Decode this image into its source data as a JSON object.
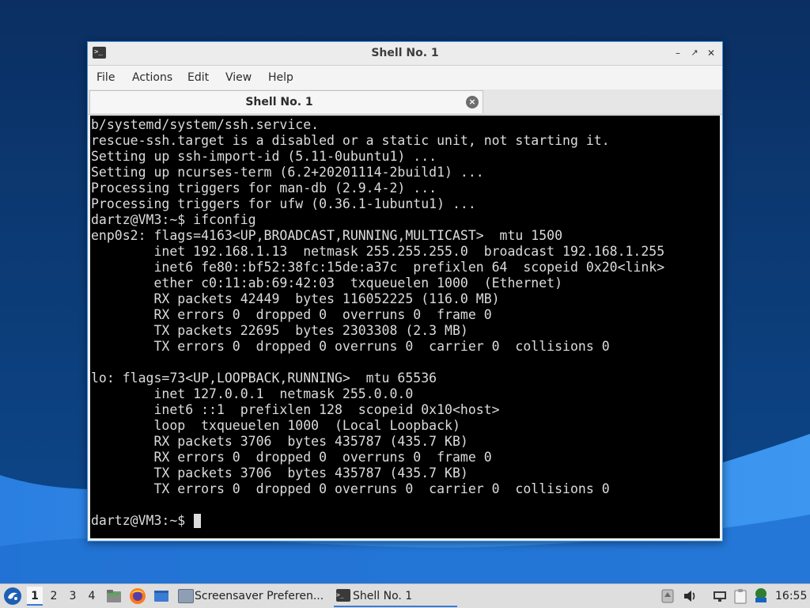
{
  "window": {
    "title": "Shell No. 1",
    "menu": {
      "file": "File",
      "actions": "Actions",
      "edit": "Edit",
      "view": "View",
      "help": "Help"
    },
    "tab": {
      "label": "Shell No. 1"
    },
    "controls": {
      "minimize": "–",
      "maximize": "↗",
      "close": "✕"
    }
  },
  "terminal": {
    "lines": [
      "b/systemd/system/ssh.service.",
      "rescue-ssh.target is a disabled or a static unit, not starting it.",
      "Setting up ssh-import-id (5.11-0ubuntu1) ...",
      "Setting up ncurses-term (6.2+20201114-2build1) ...",
      "Processing triggers for man-db (2.9.4-2) ...",
      "Processing triggers for ufw (0.36.1-1ubuntu1) ...",
      "dartz@VM3:~$ ifconfig",
      "enp0s2: flags=4163<UP,BROADCAST,RUNNING,MULTICAST>  mtu 1500",
      "        inet 192.168.1.13  netmask 255.255.255.0  broadcast 192.168.1.255",
      "        inet6 fe80::bf52:38fc:15de:a37c  prefixlen 64  scopeid 0x20<link>",
      "        ether c0:11:ab:69:42:03  txqueuelen 1000  (Ethernet)",
      "        RX packets 42449  bytes 116052225 (116.0 MB)",
      "        RX errors 0  dropped 0  overruns 0  frame 0",
      "        TX packets 22695  bytes 2303308 (2.3 MB)",
      "        TX errors 0  dropped 0 overruns 0  carrier 0  collisions 0",
      "",
      "lo: flags=73<UP,LOOPBACK,RUNNING>  mtu 65536",
      "        inet 127.0.0.1  netmask 255.0.0.0",
      "        inet6 ::1  prefixlen 128  scopeid 0x10<host>",
      "        loop  txqueuelen 1000  (Local Loopback)",
      "        RX packets 3706  bytes 435787 (435.7 KB)",
      "        RX errors 0  dropped 0  overruns 0  frame 0",
      "        TX packets 3706  bytes 435787 (435.7 KB)",
      "        TX errors 0  dropped 0 overruns 0  carrier 0  collisions 0",
      "",
      "dartz@VM3:~$ "
    ]
  },
  "taskbar": {
    "workspaces": [
      "1",
      "2",
      "3",
      "4"
    ],
    "tasks": [
      {
        "label": "Screensaver Preferen...",
        "icon": "screensaver-icon"
      },
      {
        "label": "Shell No. 1",
        "icon": "terminal-icon"
      }
    ],
    "launchers": [
      "file-manager-icon",
      "firefox-icon",
      "show-desktop-icon"
    ],
    "tray_icons": [
      "bin-icon",
      "volume-icon",
      "network-icon",
      "clipboard-icon",
      "update-notifier-icon"
    ],
    "clock": "16:55"
  },
  "colors": {
    "desktop_bg": "#0b3d7a",
    "window_border": "#3c8fe0",
    "terminal_bg": "#000000",
    "terminal_fg": "#dcdcdc",
    "accent": "#3a7bd5"
  }
}
